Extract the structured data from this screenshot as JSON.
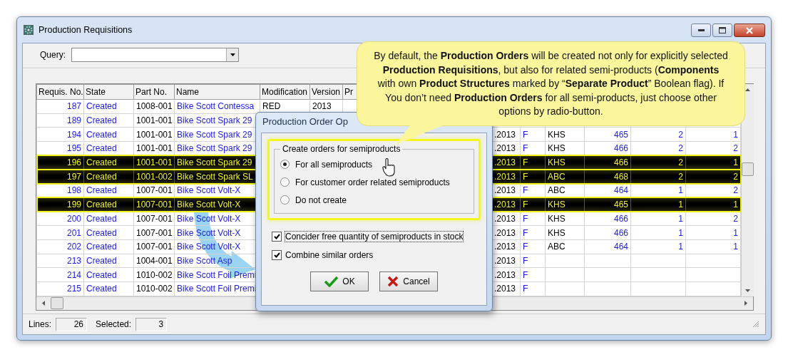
{
  "window": {
    "title": "Production Requisitions"
  },
  "query": {
    "label": "Query:"
  },
  "table": {
    "columns": [
      "Requis. No.",
      "State",
      "Part No.",
      "Name",
      "Modification",
      "Version",
      "Pr"
    ],
    "rows": [
      {
        "requis_no": "187",
        "state": "Created",
        "part_no": "1008-001",
        "name": "Bike Scott Contessa",
        "modification": "RED",
        "version": "2013",
        "selected": false
      },
      {
        "requis_no": "189",
        "state": "Created",
        "part_no": "1001-001",
        "name": "Bike Scott Spark 29",
        "selected": false
      },
      {
        "requis_no": "194",
        "state": "Created",
        "part_no": "1001-001",
        "name": "Bike Scott Spark 29",
        "date": ".2013",
        "column_9": "F",
        "column_10": "KHS",
        "column_11": "465",
        "column_12": "2",
        "column_13": "1",
        "selected": false
      },
      {
        "requis_no": "195",
        "state": "Created",
        "part_no": "1001-001",
        "name": "Bike Scott Spark 29",
        "date": ".2013",
        "column_9": "F",
        "column_10": "KHS",
        "column_11": "466",
        "column_12": "2",
        "column_13": "2",
        "selected": false
      },
      {
        "requis_no": "196",
        "state": "Created",
        "part_no": "1001-001",
        "name": "Bike Scott Spark 29",
        "date": ".2013",
        "column_9": "F",
        "column_10": "KHS",
        "column_11": "466",
        "column_12": "2",
        "column_13": "1",
        "selected": true
      },
      {
        "requis_no": "197",
        "state": "Created",
        "part_no": "1001-002",
        "name": "Bike Scott Spark SL",
        "date": ".2013",
        "column_9": "F",
        "column_10": "ABC",
        "column_11": "468",
        "column_12": "2",
        "column_13": "2",
        "selected": true
      },
      {
        "requis_no": "198",
        "state": "Created",
        "part_no": "1007-001",
        "name": "Bike Scott Volt-X",
        "date": ".2013",
        "column_9": "F",
        "column_10": "ABC",
        "column_11": "464",
        "column_12": "1",
        "column_13": "2",
        "selected": false
      },
      {
        "requis_no": "199",
        "state": "Created",
        "part_no": "1007-001",
        "name": "Bike Scott Volt-X",
        "date": ".2013",
        "column_9": "F",
        "column_10": "KHS",
        "column_11": "465",
        "column_12": "1",
        "column_13": "1",
        "selected": true
      },
      {
        "requis_no": "200",
        "state": "Created",
        "part_no": "1007-001",
        "name": "Bike Scott Volt-X",
        "date": ".2013",
        "column_9": "F",
        "column_10": "KHS",
        "column_11": "466",
        "column_12": "1",
        "column_13": "2",
        "selected": false
      },
      {
        "requis_no": "201",
        "state": "Created",
        "part_no": "1007-001",
        "name": "Bike Scott Volt-X",
        "date": ".2013",
        "column_9": "F",
        "column_10": "KHS",
        "column_11": "466",
        "column_12": "1",
        "column_13": "1",
        "selected": false
      },
      {
        "requis_no": "202",
        "state": "Created",
        "part_no": "1007-001",
        "name": "Bike Scott Volt-X",
        "date": ".2013",
        "column_9": "F",
        "column_10": "ABC",
        "column_11": "464",
        "column_12": "1",
        "column_13": "1",
        "selected": false
      },
      {
        "requis_no": "213",
        "state": "Created",
        "part_no": "1004-001",
        "name": "Bike Scott Asp",
        "date": ".2013",
        "column_9": "F",
        "selected": false
      },
      {
        "requis_no": "214",
        "state": "Created",
        "part_no": "1010-002",
        "name": "Bike Scott Foil Premi",
        "date": ".2013",
        "column_9": "F",
        "selected": false
      },
      {
        "requis_no": "215",
        "state": "Created",
        "part_no": "1010-002",
        "name": "Bike Scott Foil Premi",
        "date": ".2013",
        "column_9": "F",
        "selected": false
      }
    ]
  },
  "status_bar": {
    "lines_label": "Lines:",
    "lines": "26",
    "selected_label": "Selected:",
    "selected": "3"
  },
  "dialog": {
    "title": "Production Order Op",
    "group_title": "Create orders for semiproducts",
    "radios": [
      {
        "label": "For all semiproducts",
        "selected": true
      },
      {
        "label": "For customer order related semiproducts",
        "selected": false
      },
      {
        "label": "Do not create",
        "selected": false
      }
    ],
    "checkboxes": [
      {
        "label": "Concider free quantity of semiproducts in stock",
        "checked": true
      },
      {
        "label": "Combine similar orders",
        "checked": true
      }
    ],
    "buttons": [
      {
        "kind": "ok",
        "label": "OK"
      },
      {
        "kind": "cancel",
        "label": "Cancel"
      }
    ]
  },
  "callout": {
    "text": "By default, the **Production Orders** will be created not only for explicitly selected **Production Requisitions**, but also for related semi-products (**Components** with own **Product Structures** marked by “**Separate Product**” Boolean flag). If You don’t need **Production Orders** for all semi-products, just choose other options by radio-button."
  }
}
